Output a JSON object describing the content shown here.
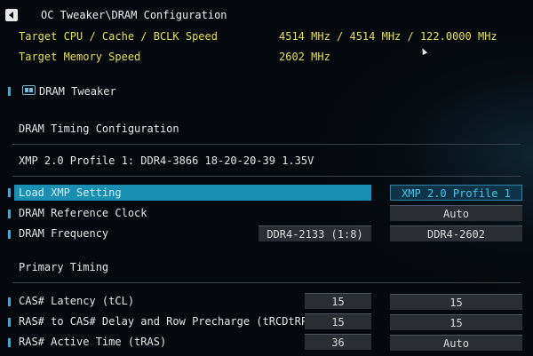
{
  "breadcrumb": "OC Tweaker\\DRAM Configuration",
  "info": {
    "cpu_label": "Target CPU / Cache / BCLK Speed",
    "cpu_value": "4514 MHz / 4514 MHz / 122.0000 MHz",
    "mem_label": "Target Memory Speed",
    "mem_value": "2602 MHz"
  },
  "dram_tweaker": "DRAM Tweaker",
  "timing_config": "DRAM Timing Configuration",
  "xmp_profile_info": "XMP 2.0 Profile 1: DDR4-3866 18-20-20-39 1.35V",
  "rows": {
    "load_xmp": {
      "label": "Load XMP Setting",
      "value": "XMP 2.0 Profile 1"
    },
    "ref_clock": {
      "label": "DRAM Reference Clock",
      "value": "Auto"
    },
    "frequency": {
      "label": "DRAM Frequency",
      "current": "DDR4-2133 (1:8)",
      "value": "DDR4-2602"
    }
  },
  "primary_timing": "Primary Timing",
  "timings": {
    "cas": {
      "label": "CAS# Latency (tCL)",
      "current": "15",
      "value": "15"
    },
    "rcd_rp": {
      "label": "RAS# to CAS# Delay and Row Precharge (tRCDtRP)",
      "current": "15",
      "value": "15"
    },
    "ras": {
      "label": "RAS# Active Time (tRAS)",
      "current": "36",
      "value": "Auto"
    }
  },
  "colors": {
    "accent": "#1b8fb3",
    "yellow": "#e8e050",
    "active_text": "#42c8f0"
  }
}
